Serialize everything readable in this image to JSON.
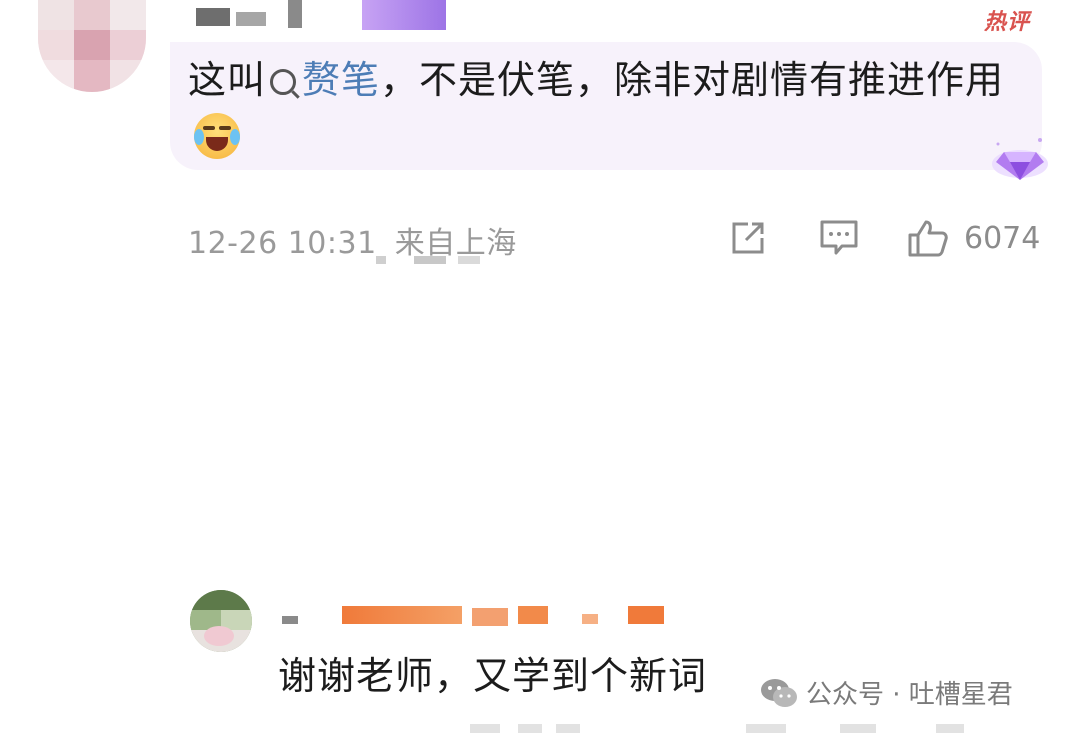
{
  "comment": {
    "hot_badge": "热评",
    "text_before": "这叫",
    "search_term": "赘笔",
    "text_after": "，不是伏笔，除非对剧情有推进作用",
    "emoji": "laughing-crying-emoji",
    "date": "12-26 10:31",
    "location": "来自上海",
    "like_count": "6074",
    "colors": {
      "bubble": "#f7f2fb",
      "link": "#4d7db6",
      "hot": "#d9534f",
      "meta": "#9a9a9a"
    }
  },
  "reply": {
    "text": "谢谢老师，又学到个新词"
  },
  "watermark": {
    "text": "公众号 · 吐槽星君"
  },
  "icons": [
    "share-icon",
    "comment-icon",
    "like-icon",
    "diamond-badge-icon",
    "wechat-icon"
  ]
}
